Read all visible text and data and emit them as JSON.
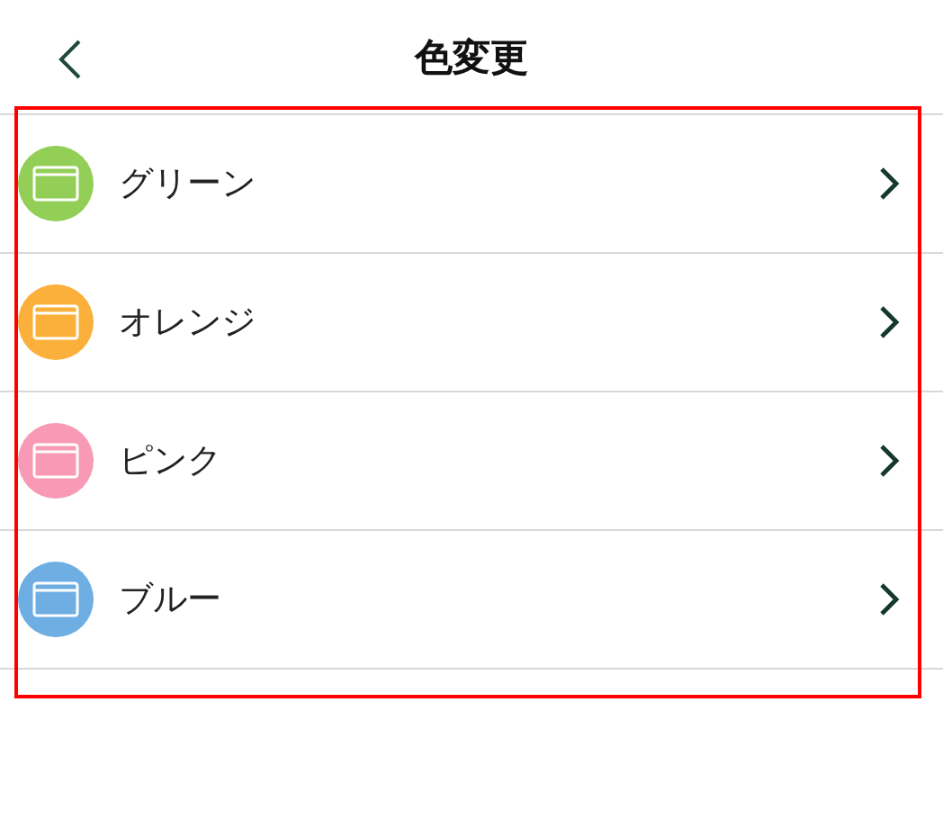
{
  "header": {
    "title": "色変更"
  },
  "colors": [
    {
      "label": "グリーン",
      "color": "#93cf57"
    },
    {
      "label": "オレンジ",
      "color": "#fcb03c"
    },
    {
      "label": "ピンク",
      "color": "#f89ab5"
    },
    {
      "label": "ブルー",
      "color": "#6eaee3"
    }
  ]
}
